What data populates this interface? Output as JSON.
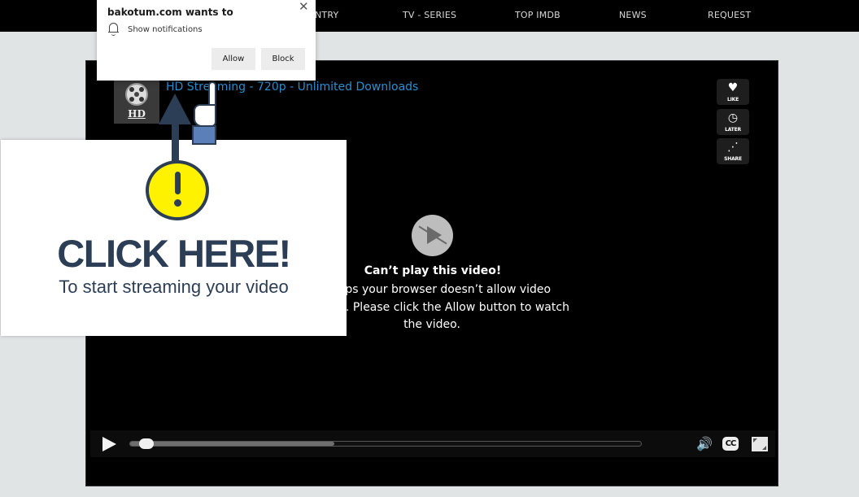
{
  "nav": {
    "items": [
      "COUNTRY",
      "TV - SERIES",
      "TOP IMDB",
      "NEWS",
      "REQUEST"
    ],
    "visible_partial_first": "NTRY"
  },
  "notification": {
    "site": "bakotum.com wants to",
    "permission": "Show notifications",
    "allow_label": "Allow",
    "block_label": "Block",
    "close_glyph": "✕",
    "icon": "bell-icon"
  },
  "player": {
    "logo_text": "HD",
    "title": "HD Streaming - 720p - Unlimited Downloads",
    "side_buttons": [
      {
        "label": "LIKE",
        "icon": "heart-icon",
        "glyph": "♥"
      },
      {
        "label": "LATER",
        "icon": "clock-icon",
        "glyph": "◷"
      },
      {
        "label": "SHARE",
        "icon": "share-icon",
        "glyph": "⋰"
      }
    ],
    "error_title": "Can’t play this video!",
    "error_body": "Perhaps your browser doesn’t allow video playback. Please click the Allow button to watch the video.",
    "controls": {
      "progress_fraction": 0.0,
      "buffered_fraction": 0.4,
      "volume_glyph": "🔊",
      "cc_label": "CC"
    }
  },
  "ad": {
    "headline": "CLICK HERE!",
    "subline": "To start streaming your video",
    "accent_color": "#fff200",
    "text_color": "#2c3e55"
  }
}
